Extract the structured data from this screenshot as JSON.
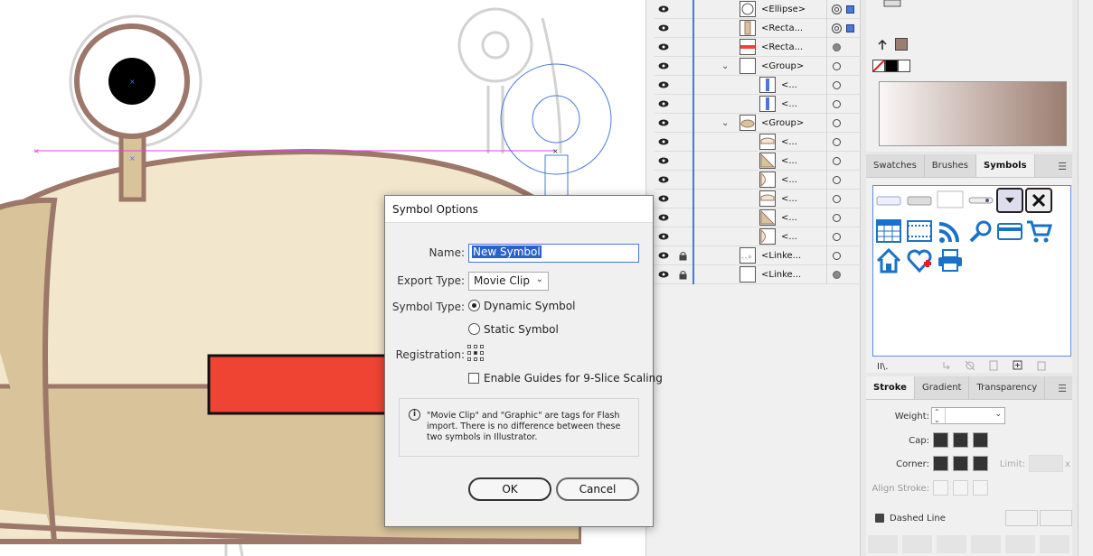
{
  "colors": {
    "body_fill": "#f2e6cc",
    "body_lower": "#d8c39a",
    "outline": "#9c776a",
    "stalk": "#d8c39a",
    "mouth": "#ef4433",
    "guide_magenta": "#e040e0",
    "selection_blue": "#4a78d8",
    "gradient_start": "#faf7f6",
    "gradient_end": "#9c7d71"
  },
  "layers": [
    {
      "name": "<Ellipse>",
      "indent": 0,
      "has_chevron": false,
      "locked": false,
      "target": "double",
      "selected": true,
      "thumb": "ellipse"
    },
    {
      "name": "<Recta...",
      "indent": 0,
      "has_chevron": false,
      "locked": false,
      "target": "double",
      "selected": true,
      "thumb": "stalk"
    },
    {
      "name": "<Recta...",
      "indent": 0,
      "has_chevron": false,
      "locked": false,
      "target": "filled",
      "selected": false,
      "thumb": "redbar"
    },
    {
      "name": "<Group>",
      "indent": 0,
      "has_chevron": true,
      "locked": false,
      "target": "open",
      "selected": false,
      "thumb": "blank"
    },
    {
      "name": "<...",
      "indent": 1,
      "has_chevron": false,
      "locked": false,
      "target": "open",
      "selected": false,
      "thumb": "bluebar"
    },
    {
      "name": "<...",
      "indent": 1,
      "has_chevron": false,
      "locked": false,
      "target": "open",
      "selected": false,
      "thumb": "bluebar"
    },
    {
      "name": "<Group>",
      "indent": 0,
      "has_chevron": true,
      "locked": false,
      "target": "open",
      "selected": false,
      "thumb": "body"
    },
    {
      "name": "<...",
      "indent": 1,
      "has_chevron": false,
      "locked": false,
      "target": "open",
      "selected": false,
      "thumb": "piece"
    },
    {
      "name": "<...",
      "indent": 1,
      "has_chevron": false,
      "locked": false,
      "target": "open",
      "selected": false,
      "thumb": "piece2"
    },
    {
      "name": "<...",
      "indent": 1,
      "has_chevron": false,
      "locked": false,
      "target": "open",
      "selected": false,
      "thumb": "piece3"
    },
    {
      "name": "<...",
      "indent": 1,
      "has_chevron": false,
      "locked": false,
      "target": "open",
      "selected": false,
      "thumb": "piece"
    },
    {
      "name": "<...",
      "indent": 1,
      "has_chevron": false,
      "locked": false,
      "target": "open",
      "selected": false,
      "thumb": "piece2"
    },
    {
      "name": "<...",
      "indent": 1,
      "has_chevron": false,
      "locked": false,
      "target": "open",
      "selected": false,
      "thumb": "piece3"
    },
    {
      "name": "<Linke...",
      "indent": 0,
      "has_chevron": false,
      "locked": true,
      "target": "open",
      "selected": false,
      "thumb": "sketch"
    },
    {
      "name": "<Linke...",
      "indent": 0,
      "has_chevron": false,
      "locked": true,
      "target": "filled",
      "selected": false,
      "thumb": "blank"
    }
  ],
  "symbols_panel": {
    "tabs": [
      "Swatches",
      "Brushes",
      "Symbols"
    ],
    "active_tab": "Symbols",
    "symbol_icons": [
      "button-flat-icon",
      "button-gradient-icon",
      "button-blank-icon",
      "slider-icon",
      "dropdown-icon",
      "close-x-icon",
      "calendar-icon",
      "film-icon",
      "rss-icon",
      "search-icon",
      "card-icon",
      "cart-icon",
      "home-icon",
      "heart-add-icon",
      "printer-icon"
    ]
  },
  "stroke_panel": {
    "tabs": [
      "Stroke",
      "Gradient",
      "Transparency"
    ],
    "active_tab": "Stroke",
    "weight_label": "Weight:",
    "cap_label": "Cap:",
    "corner_label": "Corner:",
    "limit_label": "Limit:",
    "limit_unit": "x",
    "align_label": "Align Stroke:",
    "dashed_label": "Dashed Line"
  },
  "dialog": {
    "title": "Symbol Options",
    "name_label": "Name:",
    "name_value": "New Symbol",
    "export_type_label": "Export Type:",
    "export_type_value": "Movie Clip",
    "symbol_type_label": "Symbol Type:",
    "dynamic_label": "Dynamic Symbol",
    "static_label": "Static Symbol",
    "selected_type": "Dynamic Symbol",
    "registration_label": "Registration:",
    "nine_slice_label": "Enable Guides for 9-Slice Scaling",
    "nine_slice_checked": false,
    "info_text": "\"Movie Clip\" and \"Graphic\" are tags for Flash import. There is no difference between these two symbols in Illustrator.",
    "ok_label": "OK",
    "cancel_label": "Cancel"
  }
}
